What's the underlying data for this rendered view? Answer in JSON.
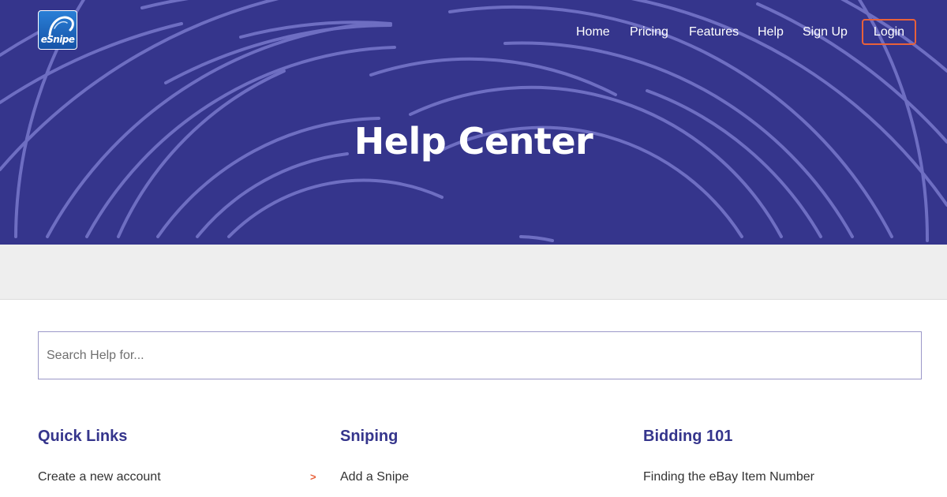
{
  "brand": {
    "logo_text": "eSnipe",
    "colors": {
      "hero_bg": "#35358c",
      "accent": "#e8613a",
      "heading": "#35358c",
      "band": "#eeeeee"
    }
  },
  "nav": {
    "items": [
      "Home",
      "Pricing",
      "Features",
      "Help",
      "Sign Up"
    ],
    "login_label": "Login"
  },
  "hero": {
    "title": "Help Center"
  },
  "search": {
    "placeholder": "Search Help for..."
  },
  "sections": [
    {
      "title": "Quick Links",
      "links": [
        "Create a new account"
      ]
    },
    {
      "title": "Sniping",
      "links": [
        "Add a Snipe"
      ]
    },
    {
      "title": "Bidding 101",
      "links": [
        "Finding the eBay Item Number"
      ]
    }
  ],
  "arrow_glyph": ">"
}
